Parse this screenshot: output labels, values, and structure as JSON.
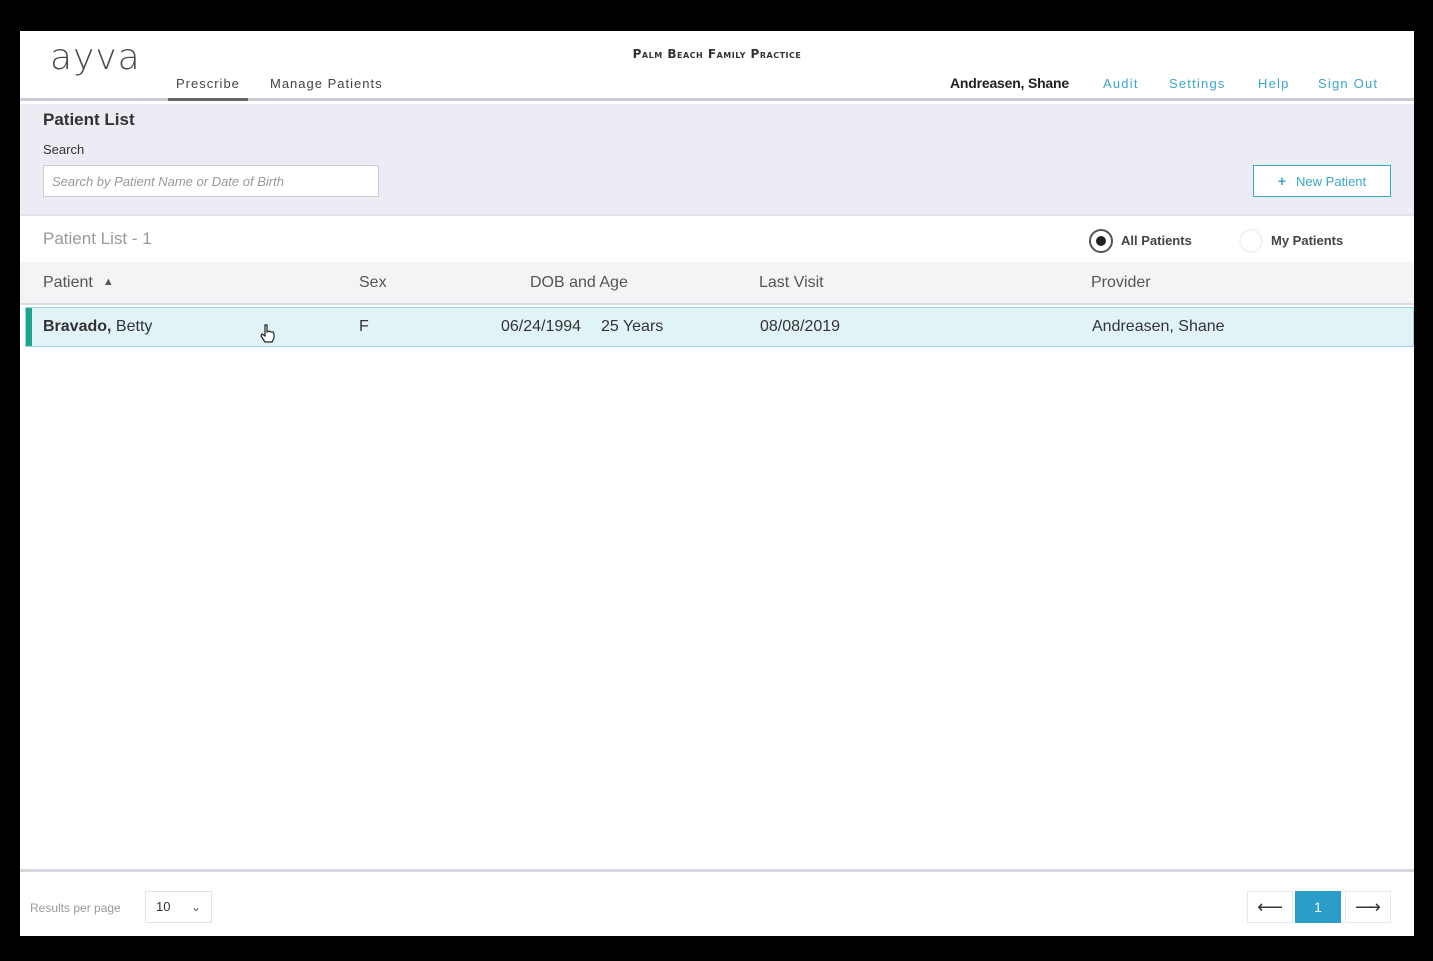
{
  "header": {
    "logo": "ayva",
    "practice": "Palm Beach Family Practice",
    "tabs": [
      {
        "label": "Prescribe",
        "active": true
      },
      {
        "label": "Manage Patients",
        "active": false
      }
    ],
    "user": "Andreasen, Shane",
    "links": [
      "Audit",
      "Settings",
      "Help",
      "Sign Out"
    ]
  },
  "panel": {
    "title": "Patient List",
    "search_label": "Search",
    "search_placeholder": "Search by Patient Name or Date of Birth",
    "new_patient_label": "New Patient"
  },
  "list": {
    "count_label": "Patient List - 1",
    "filters": [
      {
        "label": "All Patients",
        "selected": true
      },
      {
        "label": "My Patients",
        "selected": false
      }
    ]
  },
  "table": {
    "columns": [
      "Patient",
      "Sex",
      "DOB and Age",
      "Last Visit",
      "Provider"
    ],
    "rows": [
      {
        "last_name": "Bravado,",
        "first_name": "Betty",
        "sex": "F",
        "dob": "06/24/1994",
        "age": "25 Years",
        "last_visit": "08/08/2019",
        "provider": "Andreasen, Shane"
      }
    ]
  },
  "footer": {
    "rpp_label": "Results per page",
    "rpp_value": "10",
    "current_page": "1"
  },
  "colors": {
    "accent": "#3aa7c6",
    "active_page": "#2a9dc8",
    "row_highlight": "#e2f3f8",
    "row_accent": "#1ea589"
  },
  "icons": [
    "sort-ascending-icon",
    "plus-icon",
    "chevron-down-icon",
    "arrow-left-icon",
    "arrow-right-icon",
    "hand-cursor-icon"
  ]
}
